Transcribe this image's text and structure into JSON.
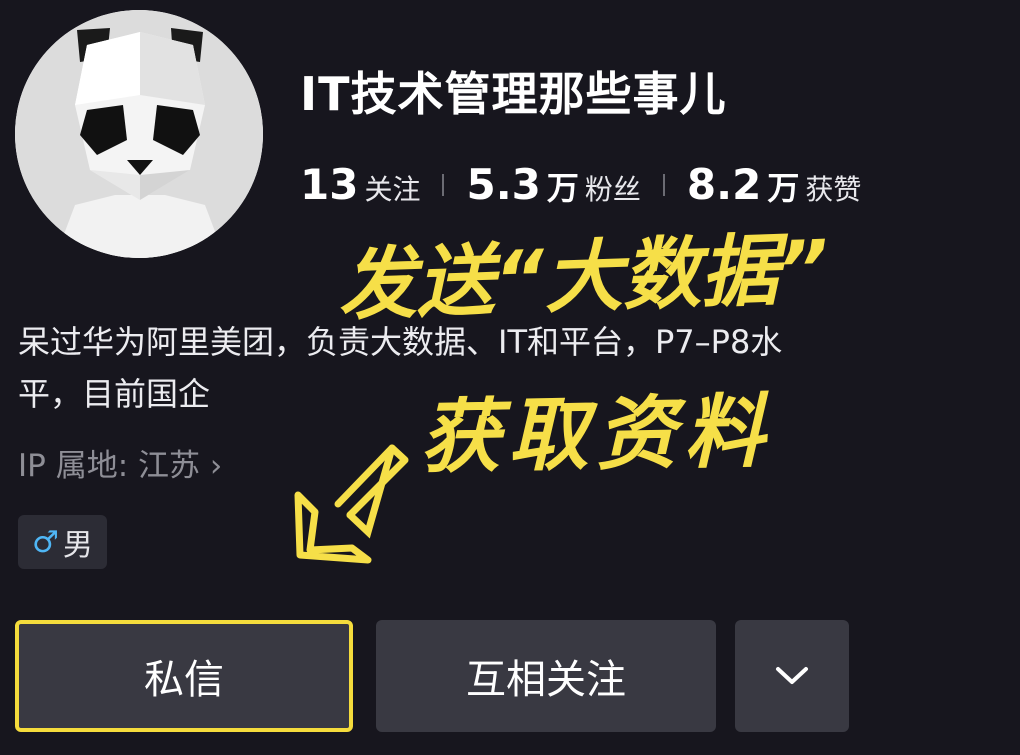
{
  "profile": {
    "username": "IT技术管理那些事儿",
    "stats": {
      "following_count": "13",
      "following_label": "关注",
      "followers_count": "5.3",
      "followers_unit": "万",
      "followers_label": "粉丝",
      "likes_count": "8.2",
      "likes_unit": "万",
      "likes_label": "获赞"
    },
    "bio_line1": "呆过华为阿里美团，负责大数据、IT和平台，P7–P8水",
    "bio_line2": "平，目前国企",
    "ip_location": "IP 属地: 江苏 ›",
    "gender_icon": "male-symbol-icon",
    "gender_symbol": "♂",
    "gender_label": "男"
  },
  "actions": {
    "message_label": "私信",
    "mutual_follow_label": "互相关注",
    "more_icon": "chevron-down-icon"
  },
  "overlay": {
    "line1": "发送“大数据”",
    "line2": "获取资料",
    "color": "#f6df48"
  },
  "colors": {
    "background": "#17161e",
    "button": "#393942",
    "highlight_border": "#f5dc3c",
    "gender_icon": "#4fb6f5",
    "muted_text": "#8e8e96"
  }
}
